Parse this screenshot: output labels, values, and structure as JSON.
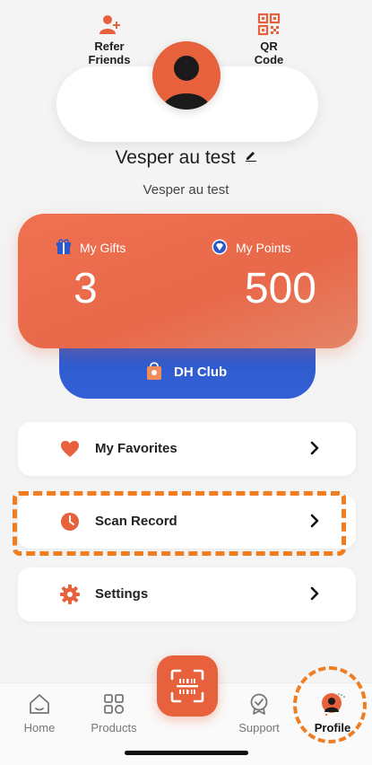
{
  "header": {
    "refer_label": "Refer\nFriends",
    "qr_label": "QR\nCode"
  },
  "profile": {
    "name": "Vesper au test",
    "subtitle": "Vesper au test"
  },
  "points_card": {
    "gifts_label": "My Gifts",
    "gifts_value": "3",
    "points_label": "My Points",
    "points_value": "500"
  },
  "club": {
    "label": "DH Club"
  },
  "menu": {
    "favorites": "My Favorites",
    "scan_record": "Scan Record",
    "settings": "Settings"
  },
  "bottom_nav": {
    "home": "Home",
    "products": "Products",
    "support": "Support",
    "profile": "Profile"
  },
  "colors": {
    "accent": "#e8613d",
    "club_blue": "#3360d6",
    "annotation_orange": "#ef7d22"
  }
}
